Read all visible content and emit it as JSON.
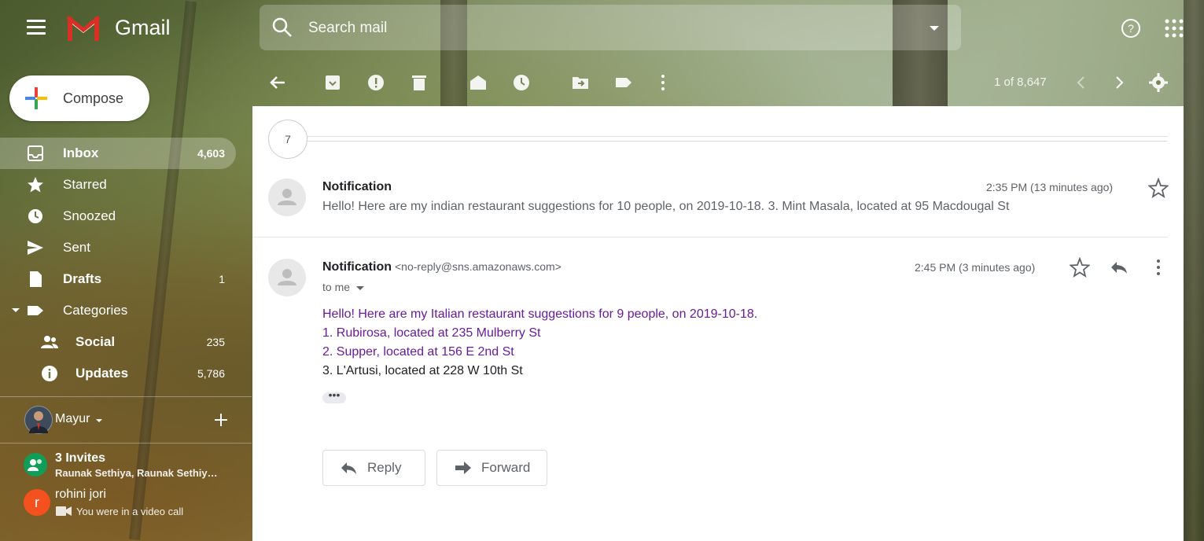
{
  "app": {
    "name": "Gmail"
  },
  "search": {
    "placeholder": "Search mail"
  },
  "toolbar": {
    "pager": "1 of 8,647"
  },
  "sidebar": {
    "compose_label": "Compose",
    "items": [
      {
        "label": "Inbox",
        "count": "4,603",
        "icon": "inbox-icon"
      },
      {
        "label": "Starred",
        "count": "",
        "icon": "star-icon"
      },
      {
        "label": "Snoozed",
        "count": "",
        "icon": "clock-icon"
      },
      {
        "label": "Sent",
        "count": "",
        "icon": "send-icon"
      },
      {
        "label": "Drafts",
        "count": "1",
        "icon": "draft-icon"
      },
      {
        "label": "Categories",
        "count": "",
        "icon": "label-icon"
      },
      {
        "label": "Social",
        "count": "235",
        "icon": "people-icon"
      },
      {
        "label": "Updates",
        "count": "5,786",
        "icon": "info-icon"
      }
    ]
  },
  "hangouts": {
    "user": "Mayur",
    "invites_title": "3 Invites",
    "invites_sub": "Raunak Sethiya, Raunak Sethiy…",
    "contact_name": "rohini jori",
    "contact_initial": "r",
    "contact_status": "You were in a video call"
  },
  "thread": {
    "collapsed_count": "7",
    "messages": [
      {
        "sender": "Notification",
        "time": "2:35 PM (13 minutes ago)",
        "snippet": "Hello! Here are my indian restaurant suggestions for 10 people, on 2019-10-18. 3. Mint Masala, located at 95 Macdougal St"
      },
      {
        "sender": "Notification",
        "email": "<no-reply@sns.amazonaws.com>",
        "to": "to me",
        "time": "2:45 PM (3 minutes ago)",
        "body": [
          "Hello! Here are my Italian restaurant suggestions for 9 people, on 2019-10-18.",
          "1. Rubirosa, located at 235 Mulberry St",
          "2. Supper, located at 156 E 2nd St",
          "3. L'Artusi, located at 228 W 10th St"
        ],
        "ellipsis": "•••"
      }
    ],
    "reply_label": "Reply",
    "forward_label": "Forward"
  },
  "colors": {
    "link_purple": "#6a1b9a",
    "compose_bg": "#ffffff",
    "avatar_red": "#f4511e",
    "invite_green": "#0f9d58"
  }
}
